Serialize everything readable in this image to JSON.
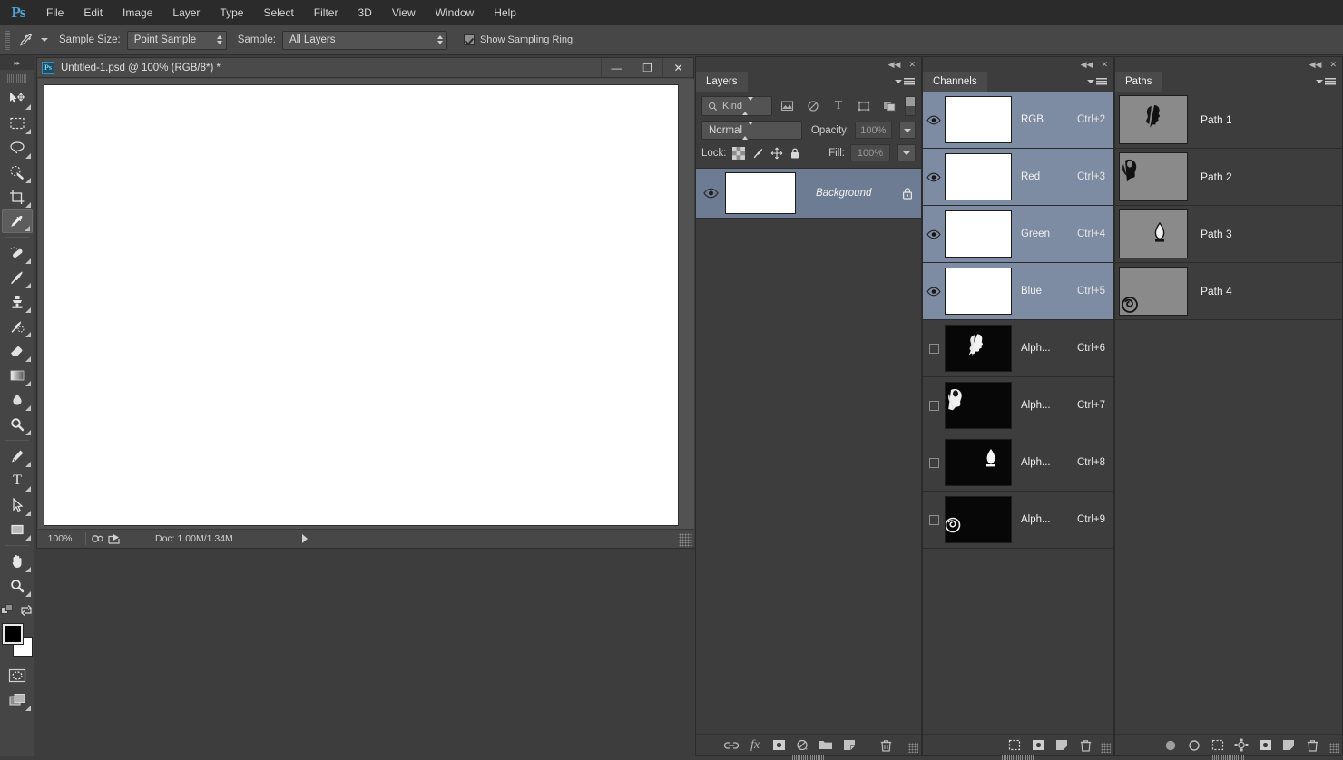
{
  "app": {
    "logo": "Ps"
  },
  "menubar": {
    "items": [
      {
        "label": "File"
      },
      {
        "label": "Edit"
      },
      {
        "label": "Image"
      },
      {
        "label": "Layer"
      },
      {
        "label": "Type"
      },
      {
        "label": "Select"
      },
      {
        "label": "Filter"
      },
      {
        "label": "3D"
      },
      {
        "label": "View"
      },
      {
        "label": "Window"
      },
      {
        "label": "Help"
      }
    ]
  },
  "options_bar": {
    "tool_icon": "eyedropper-icon",
    "sample_size_label": "Sample Size:",
    "sample_size_value": "Point Sample",
    "sample_label": "Sample:",
    "sample_value": "All Layers",
    "show_sampling_ring_label": "Show Sampling Ring",
    "show_sampling_ring_checked": true
  },
  "toolbar": {
    "collapse_label": "▸▸",
    "tools": [
      {
        "name": "move-tool",
        "active": false
      },
      {
        "name": "rectangular-marquee-tool",
        "active": false
      },
      {
        "name": "lasso-tool",
        "active": false
      },
      {
        "name": "quick-selection-tool",
        "active": false
      },
      {
        "name": "crop-tool",
        "active": false
      },
      {
        "name": "eyedropper-tool",
        "active": true
      },
      {
        "name": "healing-brush-tool",
        "active": false
      },
      {
        "name": "brush-tool",
        "active": false
      },
      {
        "name": "clone-stamp-tool",
        "active": false
      },
      {
        "name": "history-brush-tool",
        "active": false
      },
      {
        "name": "eraser-tool",
        "active": false
      },
      {
        "name": "gradient-tool",
        "active": false
      },
      {
        "name": "blur-tool",
        "active": false
      },
      {
        "name": "dodge-tool",
        "active": false
      },
      {
        "name": "pen-tool",
        "active": false
      },
      {
        "name": "type-tool",
        "active": false
      },
      {
        "name": "path-selection-tool",
        "active": false
      },
      {
        "name": "rectangle-tool",
        "active": false
      },
      {
        "name": "hand-tool",
        "active": false
      },
      {
        "name": "zoom-tool",
        "active": false
      }
    ],
    "foreground_color": "#000000",
    "background_color": "#ffffff"
  },
  "document": {
    "title": "Untitled-1.psd @ 100% (RGB/8*) *",
    "icon": "Ps",
    "window_buttons": {
      "minimize": "—",
      "maximize": "❐",
      "close": "✕"
    },
    "status": {
      "zoom": "100%",
      "doc_info": "Doc: 1.00M/1.34M"
    }
  },
  "layers_panel": {
    "tab": "Layers",
    "filter_kind": "Kind",
    "filter_icons": [
      "pixel-filter-icon",
      "adjustment-filter-icon",
      "type-filter-icon",
      "shape-filter-icon",
      "smart-object-filter-icon"
    ],
    "blend_mode": "Normal",
    "opacity_label": "Opacity:",
    "opacity_value": "100%",
    "lock_label": "Lock:",
    "fill_label": "Fill:",
    "fill_value": "100%",
    "lock_icons": [
      "lock-transparency-icon",
      "lock-image-icon",
      "lock-position-icon",
      "lock-all-icon"
    ],
    "layers": [
      {
        "name": "Background",
        "visible": true,
        "locked": true,
        "selected": true
      }
    ],
    "footer_buttons": [
      "link-layers-icon",
      "layer-style-fx-icon",
      "add-layer-mask-icon",
      "new-adjustment-layer-icon",
      "new-group-icon",
      "new-layer-icon",
      "delete-layer-icon"
    ]
  },
  "channels_panel": {
    "tab": "Channels",
    "channels": [
      {
        "name": "RGB",
        "shortcut": "Ctrl+2",
        "visible": true,
        "selected": true,
        "thumb": "white"
      },
      {
        "name": "Red",
        "shortcut": "Ctrl+3",
        "visible": true,
        "selected": true,
        "thumb": "white"
      },
      {
        "name": "Green",
        "shortcut": "Ctrl+4",
        "visible": true,
        "selected": true,
        "thumb": "white"
      },
      {
        "name": "Blue",
        "shortcut": "Ctrl+5",
        "visible": true,
        "selected": true,
        "thumb": "white"
      },
      {
        "name": "Alph...",
        "shortcut": "Ctrl+6",
        "visible": false,
        "selected": false,
        "thumb": "black"
      },
      {
        "name": "Alph...",
        "shortcut": "Ctrl+7",
        "visible": false,
        "selected": false,
        "thumb": "black"
      },
      {
        "name": "Alph...",
        "shortcut": "Ctrl+8",
        "visible": false,
        "selected": false,
        "thumb": "black"
      },
      {
        "name": "Alph...",
        "shortcut": "Ctrl+9",
        "visible": false,
        "selected": false,
        "thumb": "black"
      }
    ],
    "footer_buttons": [
      "load-channel-as-selection-icon",
      "save-selection-as-channel-icon",
      "new-channel-icon",
      "delete-channel-icon"
    ]
  },
  "paths_panel": {
    "tab": "Paths",
    "paths": [
      {
        "name": "Path 1"
      },
      {
        "name": "Path 2"
      },
      {
        "name": "Path 3"
      },
      {
        "name": "Path 4"
      }
    ],
    "footer_buttons": [
      "fill-path-icon",
      "stroke-path-icon",
      "load-path-as-selection-icon",
      "make-work-path-icon",
      "add-layer-mask-icon",
      "new-path-icon",
      "delete-path-icon"
    ]
  },
  "colors": {
    "window_bg": "#3d3d3d",
    "panel_bg": "#3d3d3d",
    "toolbar_bg": "#454545",
    "menubar_bg": "#2b2b2b",
    "selection_blue": "#7d8ba3",
    "layer_selected": "#6d7c93",
    "accent_logo": "#4da6d6"
  }
}
